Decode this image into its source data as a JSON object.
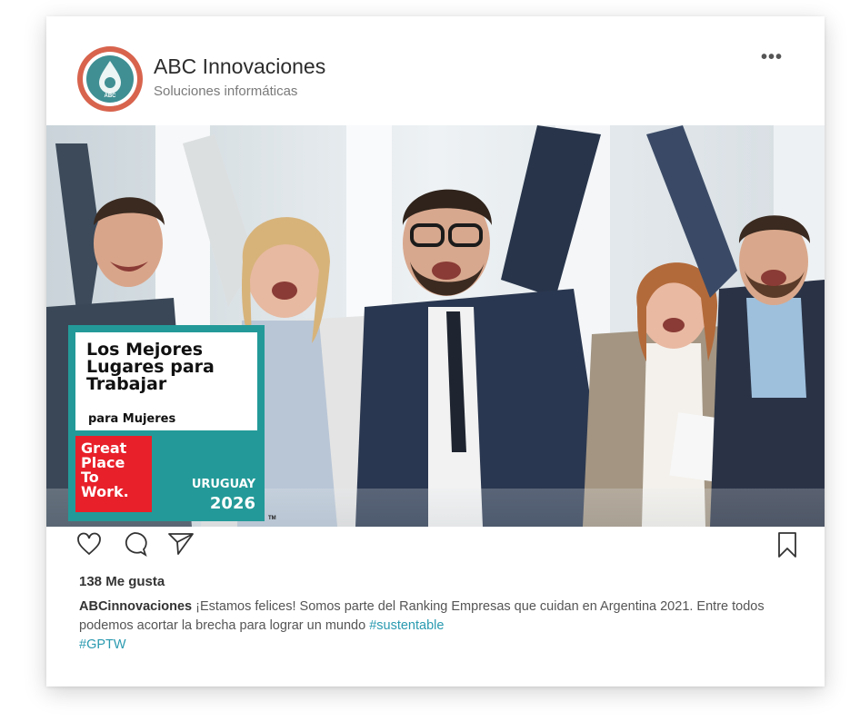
{
  "account": {
    "name": "ABC Innovaciones",
    "subtitle": "Soluciones informáticas",
    "avatar_text": "ABC",
    "more_label": "•••"
  },
  "badge": {
    "title_lines": [
      "Los Mejores",
      "Lugares para",
      "Trabajar"
    ],
    "subtitle": "para Mujeres",
    "logo_lines": [
      "Great",
      "Place",
      "To",
      "Work."
    ],
    "country": "URUGUAY",
    "year": "2026",
    "tm": "TM"
  },
  "actions": {
    "like_icon": "heart-icon",
    "comment_icon": "comment-icon",
    "share_icon": "send-icon",
    "save_icon": "bookmark-icon"
  },
  "post": {
    "likes": "138 Me gusta",
    "username": "ABCinnovaciones",
    "text": " ¡Estamos felices! Somos parte del Ranking Empresas que cuidan en Argentina 2021. Entre todos podemos acortar la brecha para lograr un mundo ",
    "hashtag1": "#sustentable",
    "hashtag2": "#GPTW"
  },
  "colors": {
    "badge_teal": "#239a99",
    "gptw_red": "#e8202a",
    "avatar_ring": "#d8644e",
    "avatar_fill": "#3f8f93",
    "hashtag": "#2a9ab0"
  }
}
